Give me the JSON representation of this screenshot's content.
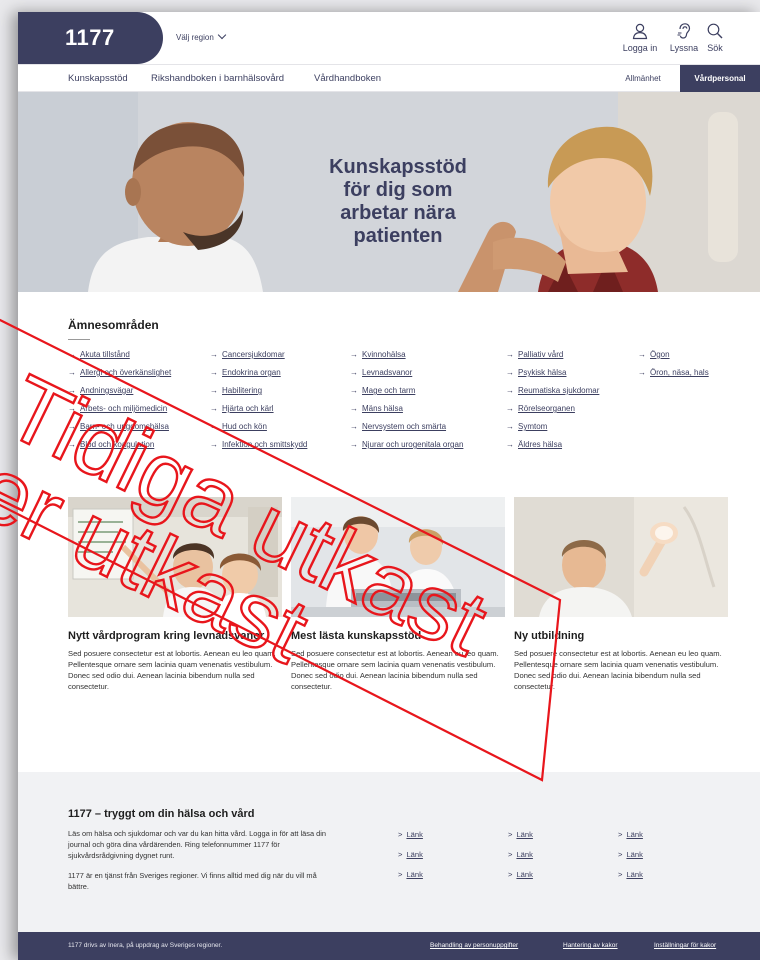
{
  "header": {
    "logo": "1177",
    "region_label": "Välj region",
    "login_label": "Logga in",
    "listen_label": "Lyssna",
    "search_label": "Sök"
  },
  "nav": {
    "items": [
      "Kunskapsstöd",
      "Rikshandboken i barnhälsovård",
      "Vårdhandboken"
    ],
    "audience_public": "Allmänhet",
    "audience_pro": "Vårdpersonal"
  },
  "hero": {
    "lines": [
      "Kunskapsstöd",
      "för dig som",
      "arbetar nära",
      "patienten"
    ]
  },
  "topics": {
    "title": "Ämnesområden",
    "arrow": "→",
    "columns": [
      [
        "Akuta tillstånd",
        "Allergi och överkänslighet",
        "Andningsvägar",
        "Arbets- och miljömedicin",
        "Barn- och ungdomshälsa",
        "Blod och koagulation"
      ],
      [
        "Cancersjukdomar",
        "Endokrina organ",
        "Habilitering",
        "Hjärta och kärl",
        "Hud och kön",
        "Infektion och smittskydd"
      ],
      [
        "Kvinnohälsa",
        "Levnadsvanor",
        "Mage och tarm",
        "Mäns hälsa",
        "Nervsystem och smärta",
        "Njurar och urogenitala organ"
      ],
      [
        "Palliativ vård",
        "Psykisk hälsa",
        "Reumatiska sjukdomar",
        "Rörelseorganen",
        "Symtom",
        "Äldres hälsa"
      ],
      [
        "Ögon",
        "Öron, näsa, hals"
      ]
    ]
  },
  "cards": [
    {
      "title": "Nytt vårdprogram kring levnadsvanor",
      "text": "Sed posuere consectetur est at lobortis. Aenean eu leo quam. Pellentesque ornare sem lacinia quam venenatis vestibulum. Donec sed odio dui. Aenean lacinia bibendum nulla sed consectetur."
    },
    {
      "title": "Mest lästa kunskapsstöd",
      "text": "Sed posuere consectetur est at lobortis. Aenean eu leo quam. Pellentesque ornare sem lacinia quam venenatis vestibulum. Donec sed odio dui. Aenean lacinia bibendum nulla sed consectetur."
    },
    {
      "title": "Ny utbildning",
      "text": "Sed posuere consectetur est at lobortis. Aenean eu leo quam. Pellentesque ornare sem lacinia quam venenatis vestibulum. Donec sed odio dui. Aenean lacinia bibendum nulla sed consectetur."
    }
  ],
  "about": {
    "title": "1177 – tryggt om din hälsa och vård",
    "p1": "Läs om hälsa och sjukdomar och var du kan hitta vård. Logga in för att läsa din journal och göra dina vårdärenden. Ring telefonnummer 1177 för sjukvårdsrådgivning dygnet runt.",
    "p2": "1177 är en tjänst från Sveriges regioner. Vi finns alltid med dig när du vill må bättre.",
    "link_prefix": ">",
    "link_label": "Länk"
  },
  "footer": {
    "text": "1177 drivs av Inera, på uppdrag av Sveriges regioner.",
    "links": [
      "Behandling av personuppgifter",
      "Hantering av kakor",
      "Inställningar för kakor"
    ]
  },
  "watermark": {
    "text_line1": "Tidiga utkast",
    "text_line2": "er utkast"
  },
  "colors": {
    "brand": "#3c3f60",
    "watermark": "#e8161c"
  }
}
